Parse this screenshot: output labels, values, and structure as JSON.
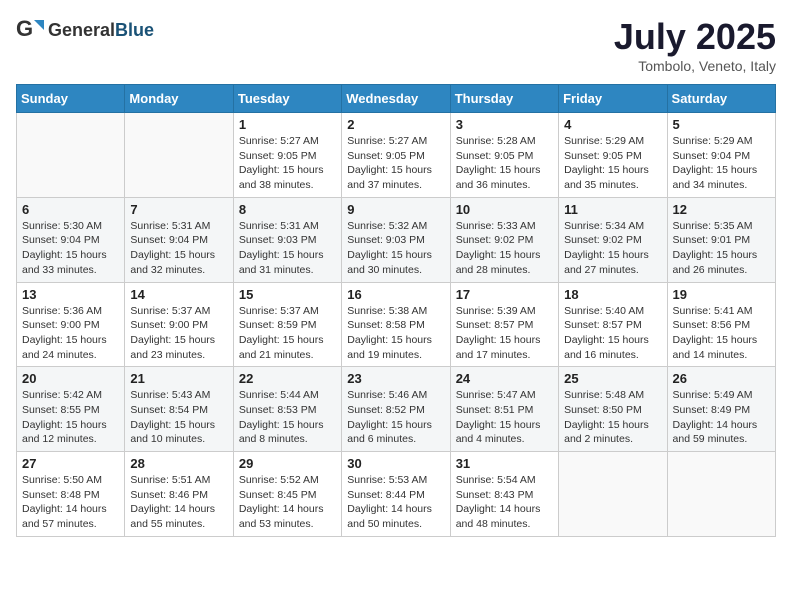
{
  "header": {
    "logo_general": "General",
    "logo_blue": "Blue",
    "month": "July 2025",
    "location": "Tombolo, Veneto, Italy"
  },
  "weekdays": [
    "Sunday",
    "Monday",
    "Tuesday",
    "Wednesday",
    "Thursday",
    "Friday",
    "Saturday"
  ],
  "weeks": [
    [
      {
        "day": "",
        "info": ""
      },
      {
        "day": "",
        "info": ""
      },
      {
        "day": "1",
        "info": "Sunrise: 5:27 AM\nSunset: 9:05 PM\nDaylight: 15 hours and 38 minutes."
      },
      {
        "day": "2",
        "info": "Sunrise: 5:27 AM\nSunset: 9:05 PM\nDaylight: 15 hours and 37 minutes."
      },
      {
        "day": "3",
        "info": "Sunrise: 5:28 AM\nSunset: 9:05 PM\nDaylight: 15 hours and 36 minutes."
      },
      {
        "day": "4",
        "info": "Sunrise: 5:29 AM\nSunset: 9:05 PM\nDaylight: 15 hours and 35 minutes."
      },
      {
        "day": "5",
        "info": "Sunrise: 5:29 AM\nSunset: 9:04 PM\nDaylight: 15 hours and 34 minutes."
      }
    ],
    [
      {
        "day": "6",
        "info": "Sunrise: 5:30 AM\nSunset: 9:04 PM\nDaylight: 15 hours and 33 minutes."
      },
      {
        "day": "7",
        "info": "Sunrise: 5:31 AM\nSunset: 9:04 PM\nDaylight: 15 hours and 32 minutes."
      },
      {
        "day": "8",
        "info": "Sunrise: 5:31 AM\nSunset: 9:03 PM\nDaylight: 15 hours and 31 minutes."
      },
      {
        "day": "9",
        "info": "Sunrise: 5:32 AM\nSunset: 9:03 PM\nDaylight: 15 hours and 30 minutes."
      },
      {
        "day": "10",
        "info": "Sunrise: 5:33 AM\nSunset: 9:02 PM\nDaylight: 15 hours and 28 minutes."
      },
      {
        "day": "11",
        "info": "Sunrise: 5:34 AM\nSunset: 9:02 PM\nDaylight: 15 hours and 27 minutes."
      },
      {
        "day": "12",
        "info": "Sunrise: 5:35 AM\nSunset: 9:01 PM\nDaylight: 15 hours and 26 minutes."
      }
    ],
    [
      {
        "day": "13",
        "info": "Sunrise: 5:36 AM\nSunset: 9:00 PM\nDaylight: 15 hours and 24 minutes."
      },
      {
        "day": "14",
        "info": "Sunrise: 5:37 AM\nSunset: 9:00 PM\nDaylight: 15 hours and 23 minutes."
      },
      {
        "day": "15",
        "info": "Sunrise: 5:37 AM\nSunset: 8:59 PM\nDaylight: 15 hours and 21 minutes."
      },
      {
        "day": "16",
        "info": "Sunrise: 5:38 AM\nSunset: 8:58 PM\nDaylight: 15 hours and 19 minutes."
      },
      {
        "day": "17",
        "info": "Sunrise: 5:39 AM\nSunset: 8:57 PM\nDaylight: 15 hours and 17 minutes."
      },
      {
        "day": "18",
        "info": "Sunrise: 5:40 AM\nSunset: 8:57 PM\nDaylight: 15 hours and 16 minutes."
      },
      {
        "day": "19",
        "info": "Sunrise: 5:41 AM\nSunset: 8:56 PM\nDaylight: 15 hours and 14 minutes."
      }
    ],
    [
      {
        "day": "20",
        "info": "Sunrise: 5:42 AM\nSunset: 8:55 PM\nDaylight: 15 hours and 12 minutes."
      },
      {
        "day": "21",
        "info": "Sunrise: 5:43 AM\nSunset: 8:54 PM\nDaylight: 15 hours and 10 minutes."
      },
      {
        "day": "22",
        "info": "Sunrise: 5:44 AM\nSunset: 8:53 PM\nDaylight: 15 hours and 8 minutes."
      },
      {
        "day": "23",
        "info": "Sunrise: 5:46 AM\nSunset: 8:52 PM\nDaylight: 15 hours and 6 minutes."
      },
      {
        "day": "24",
        "info": "Sunrise: 5:47 AM\nSunset: 8:51 PM\nDaylight: 15 hours and 4 minutes."
      },
      {
        "day": "25",
        "info": "Sunrise: 5:48 AM\nSunset: 8:50 PM\nDaylight: 15 hours and 2 minutes."
      },
      {
        "day": "26",
        "info": "Sunrise: 5:49 AM\nSunset: 8:49 PM\nDaylight: 14 hours and 59 minutes."
      }
    ],
    [
      {
        "day": "27",
        "info": "Sunrise: 5:50 AM\nSunset: 8:48 PM\nDaylight: 14 hours and 57 minutes."
      },
      {
        "day": "28",
        "info": "Sunrise: 5:51 AM\nSunset: 8:46 PM\nDaylight: 14 hours and 55 minutes."
      },
      {
        "day": "29",
        "info": "Sunrise: 5:52 AM\nSunset: 8:45 PM\nDaylight: 14 hours and 53 minutes."
      },
      {
        "day": "30",
        "info": "Sunrise: 5:53 AM\nSunset: 8:44 PM\nDaylight: 14 hours and 50 minutes."
      },
      {
        "day": "31",
        "info": "Sunrise: 5:54 AM\nSunset: 8:43 PM\nDaylight: 14 hours and 48 minutes."
      },
      {
        "day": "",
        "info": ""
      },
      {
        "day": "",
        "info": ""
      }
    ]
  ]
}
